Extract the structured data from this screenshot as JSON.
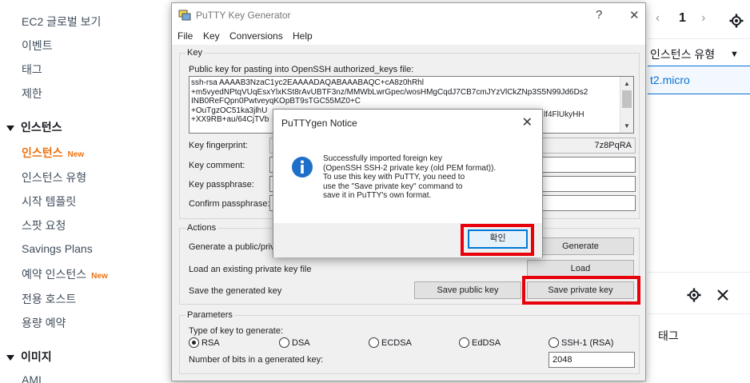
{
  "aws": {
    "sidebar": {
      "top_items": [
        "EC2 글로벌 보기",
        "이벤트",
        "태그",
        "제한"
      ],
      "instances_header": "인스턴스",
      "instance_items": [
        {
          "label": "인스턴스",
          "badge": "New"
        },
        {
          "label": "인스턴스 유형",
          "badge": ""
        },
        {
          "label": "시작 템플릿",
          "badge": ""
        },
        {
          "label": "스팟 요청",
          "badge": ""
        },
        {
          "label": "Savings Plans",
          "badge": ""
        },
        {
          "label": "예약 인스턴스",
          "badge": "New"
        },
        {
          "label": "전용 호스트",
          "badge": ""
        },
        {
          "label": "용량 예약",
          "badge": ""
        }
      ],
      "images_header": "이미지",
      "images_first_item": "AMI"
    },
    "main": {
      "page_number": "1",
      "column_header": "인스턴스 유형",
      "cell_value": "t2.micro",
      "details_tab": "태그"
    },
    "colors": {
      "accent": "#ec7211",
      "link": "#0972d3"
    }
  },
  "putty": {
    "title": "PuTTY Key Generator",
    "help_btn": "?",
    "close_btn": "✕",
    "menu": [
      "File",
      "Key",
      "Conversions",
      "Help"
    ],
    "key_group": "Key",
    "pubkey_label": "Public key for pasting into OpenSSH authorized_keys file:",
    "pubkey_lines": [
      "ssh-rsa AAAAB3NzaC1yc2EAAAADAQABAAABAQC+cA8z0hRhl",
      "+m5vyedNPtqVUqEsxYlxKSt8rAvUBTF3nz/MMWbLwrGpec/wosHMgCqdJ7CB7cmJYzVlCkZNp3S5N99Jd6Ds2",
      "INB0ReFQpn0PwtveyqKOpBT9sTGC55MZ0+C",
      "+OuTgzOC51ka3jlhU",
      "+XX9RB+au/64CjTVb"
    ],
    "pubkey_right_fragment": "lf4FlUkyHH",
    "fingerprint_label": "Key fingerprint:",
    "fingerprint_fragment": "7z8PqRA",
    "comment_label": "Key comment:",
    "passphrase_label": "Key passphrase:",
    "confirm_label": "Confirm passphrase:",
    "actions_group": "Actions",
    "generate_label": "Generate a public/priv",
    "generate_btn": "Generate",
    "load_label": "Load an existing private key file",
    "load_btn": "Load",
    "save_label": "Save the generated key",
    "save_public_btn": "Save public key",
    "save_private_btn": "Save private key",
    "params_group": "Parameters",
    "key_type_label": "Type of key to generate:",
    "key_types": [
      "RSA",
      "DSA",
      "ECDSA",
      "EdDSA",
      "SSH-1 (RSA)"
    ],
    "selected_key_type": "RSA",
    "bits_label": "Number of bits in a generated key:",
    "bits_value": "2048"
  },
  "notice": {
    "title": "PuTTYgen Notice",
    "close": "✕",
    "message_lines": [
      "Successfully imported foreign key",
      "(OpenSSH SSH-2 private key (old PEM format)).",
      "To use this key with PuTTY, you need to",
      "use the \"Save private key\" command to",
      "save it in PuTTY's own format."
    ],
    "ok_btn": "확인",
    "info_color": "#1e6fc9"
  },
  "highlight_color": "#e8000b"
}
